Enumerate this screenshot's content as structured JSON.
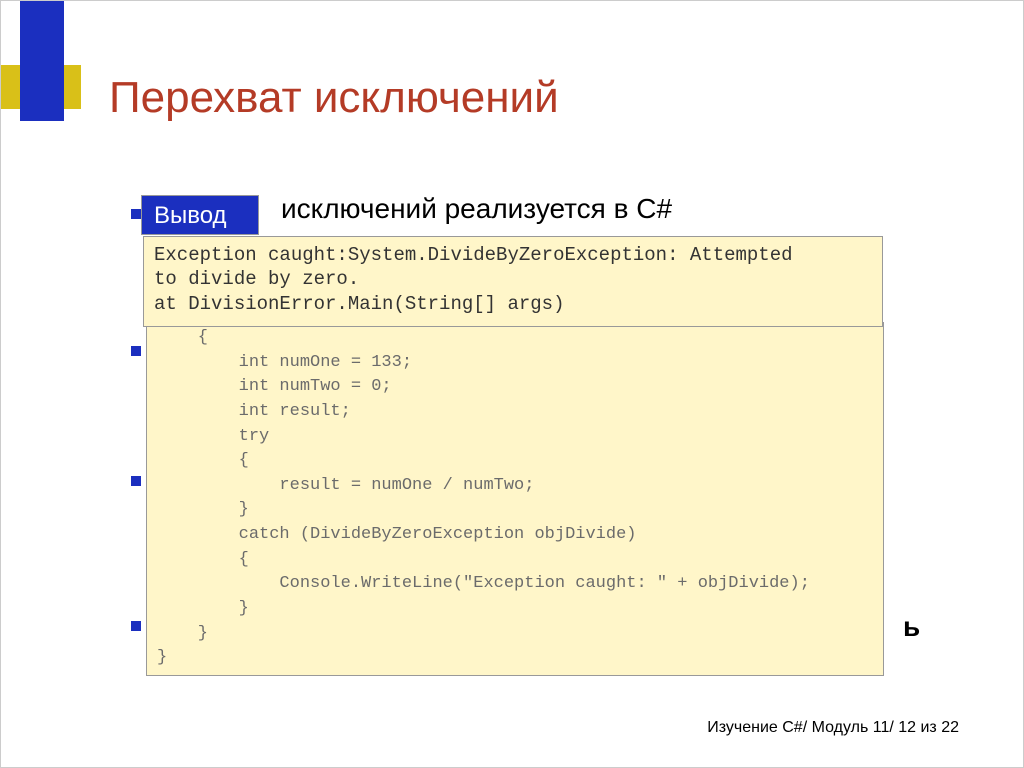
{
  "title": "Перехват исключений",
  "bullet_visible": "исключений реализуется в C#",
  "output_label": "Вывод",
  "code1": "Exception caught:System.DivideByZeroException: Attempted\nto divide by zero.\nat DivisionError.Main(String[] args)",
  "code2": "    {\n        int numOne = 133;\n        int numTwo = 0;\n        int result;\n        try\n        {\n            result = numOne / numTwo;\n        }\n        catch (DivideByZeroException objDivide)\n        {\n            Console.WriteLine(\"Exception caught: \" + objDivide);\n        }\n    }\n}",
  "stick_right": "ь",
  "footer": "Изучение C#/ Модуль 11/ 12 из 22"
}
